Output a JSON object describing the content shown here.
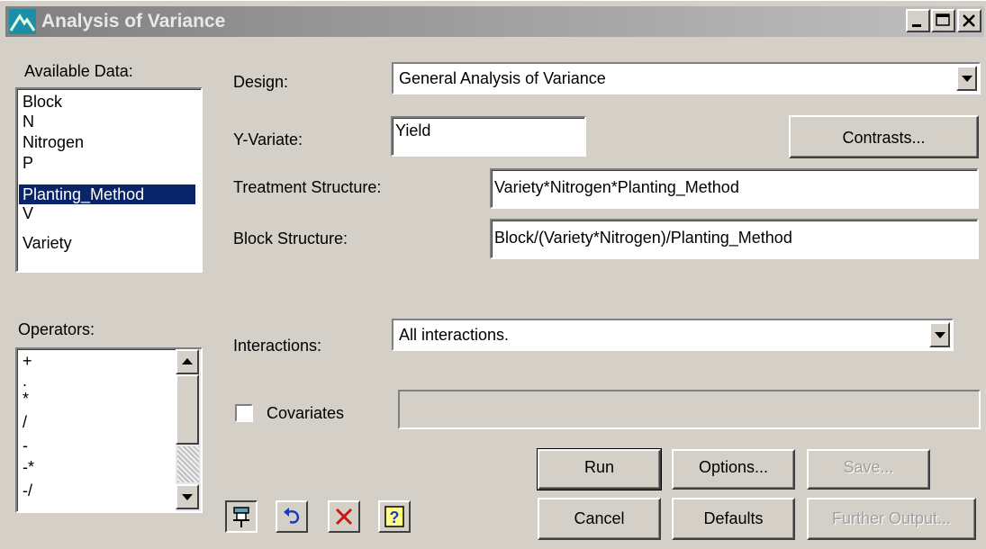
{
  "window": {
    "title": "Analysis of Variance"
  },
  "available_data": {
    "label": "Available Data:",
    "items": [
      "Block",
      "N",
      "Nitrogen",
      "P",
      "Planting_Method",
      "V",
      "Variety"
    ],
    "selected": "Planting_Method"
  },
  "operators": {
    "label": "Operators:",
    "items": [
      "+",
      ".",
      "*",
      "/",
      "-",
      "-*",
      "-/"
    ]
  },
  "design": {
    "label": "Design:",
    "value": "General Analysis of Variance"
  },
  "y_variate": {
    "label": "Y-Variate:",
    "value": "Yield"
  },
  "contrasts_button": "Contrasts...",
  "treatment_structure": {
    "label": "Treatment Structure:",
    "value": "Variety*Nitrogen*Planting_Method"
  },
  "block_structure": {
    "label": "Block Structure:",
    "value": "Block/(Variety*Nitrogen)/Planting_Method"
  },
  "interactions": {
    "label": "Interactions:",
    "value": "All interactions."
  },
  "covariates": {
    "label": "Covariates",
    "checked": false,
    "value": ""
  },
  "buttons": {
    "run": "Run",
    "options": "Options...",
    "save": "Save...",
    "cancel": "Cancel",
    "defaults": "Defaults",
    "further_output": "Further Output..."
  },
  "toolbar_icons": [
    "pin-icon",
    "undo-icon",
    "clear-icon",
    "help-icon"
  ],
  "colors": {
    "selection": "#0a246a",
    "face": "#d4d0c8",
    "title_icon": "#1c8ea8"
  }
}
